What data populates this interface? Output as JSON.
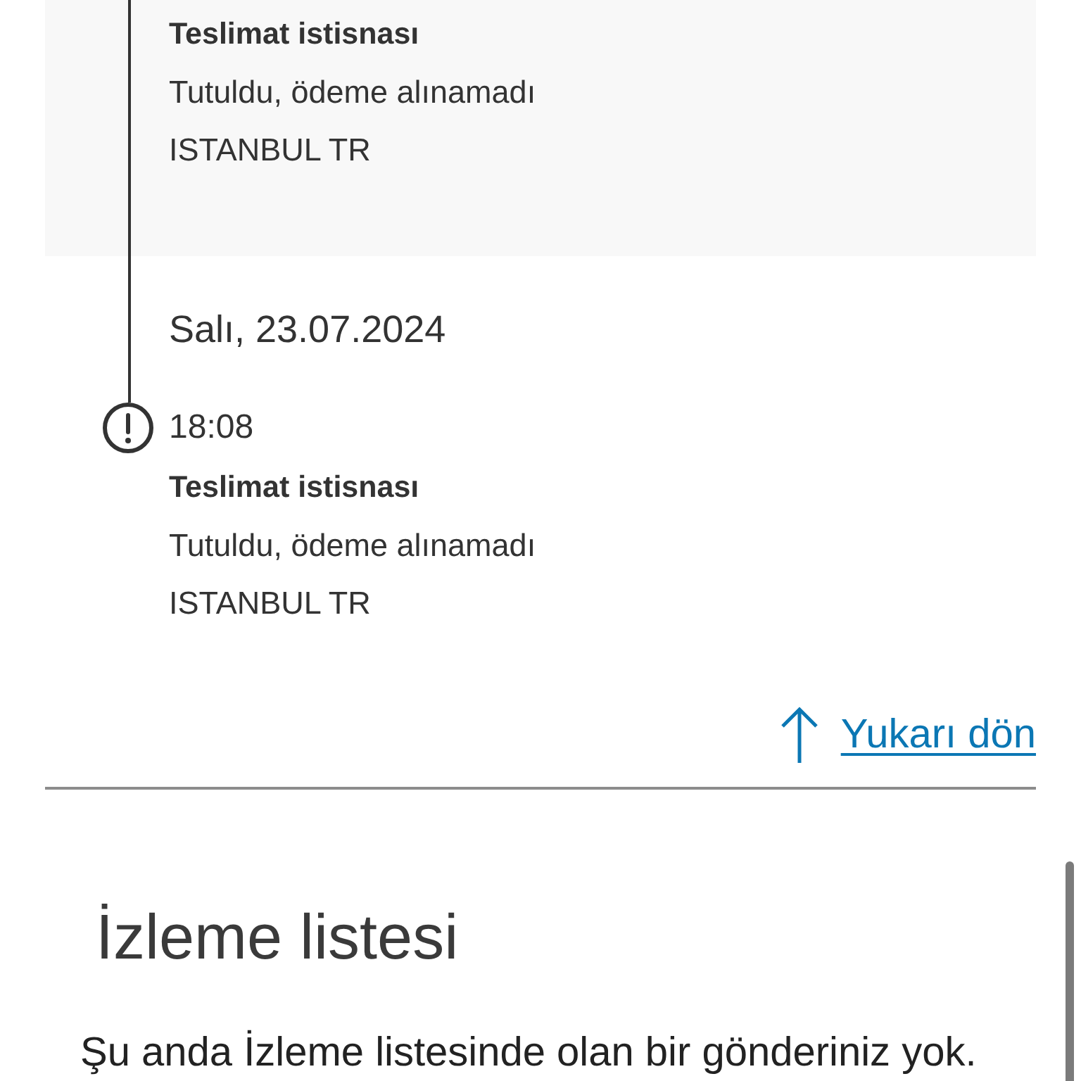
{
  "timeline": {
    "groups": [
      {
        "events": [
          {
            "highlighted": true,
            "title": "Teslimat istisnası",
            "status": "Tutuldu, ödeme alınamadı",
            "location": "ISTANBUL TR"
          }
        ]
      },
      {
        "date": "Salı, 23.07.2024",
        "events": [
          {
            "highlighted": false,
            "kind": "exception",
            "time": "18:08",
            "title": "Teslimat istisnası",
            "status": "Tutuldu, ödeme alınamadı",
            "location": "ISTANBUL TR"
          }
        ]
      }
    ]
  },
  "back_to_top": {
    "label": "Yukarı dön"
  },
  "watchlist": {
    "title": "İzleme listesi",
    "message": "Şu anda İzleme listesinde olan bir gönderiniz yok."
  }
}
